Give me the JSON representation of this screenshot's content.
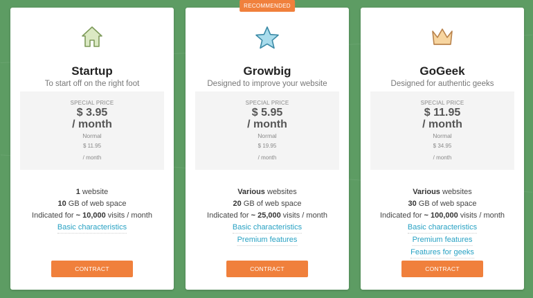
{
  "plans": [
    {
      "badge": "",
      "icon": "house-icon",
      "name": "Startup",
      "tagline": "To start off on the right foot",
      "special_label": "SPECIAL PRICE",
      "price": "$ 3.95",
      "per": "/ month",
      "normal_label": "Normal",
      "normal_price": "$ 11.95",
      "normal_per": "/ month",
      "feature_1_strong": "1",
      "feature_1_text": " website",
      "feature_2_strong": "10",
      "feature_2_text": " GB of web space",
      "feature_3_text": "Indicated for ",
      "feature_3_strong": "~ 10,000",
      "feature_3_suffix": " visits / month",
      "links": [
        "Basic characteristics"
      ],
      "cta": "CONTRACT"
    },
    {
      "badge": "RECOMMENDED",
      "icon": "star-icon",
      "name": "Growbig",
      "tagline": "Designed to improve your website",
      "special_label": "SPECIAL PRICE",
      "price": "$ 5.95",
      "per": "/ month",
      "normal_label": "Normal",
      "normal_price": "$ 19.95",
      "normal_per": "/ month",
      "feature_1_strong": "Various",
      "feature_1_text": " websites",
      "feature_2_strong": "20",
      "feature_2_text": " GB of web space",
      "feature_3_text": "Indicated for ",
      "feature_3_strong": "~ 25,000",
      "feature_3_suffix": " visits / month",
      "links": [
        "Basic characteristics",
        "Premium features"
      ],
      "cta": "CONTRACT"
    },
    {
      "badge": "",
      "icon": "crown-icon",
      "name": "GoGeek",
      "tagline": "Designed for authentic geeks",
      "special_label": "SPECIAL PRICE",
      "price": "$ 11.95",
      "per": "/ month",
      "normal_label": "Normal",
      "normal_price": "$ 34.95",
      "normal_per": "/ month",
      "feature_1_strong": "Various",
      "feature_1_text": " websites",
      "feature_2_strong": "30",
      "feature_2_text": " GB of web space",
      "feature_3_text": "Indicated for ",
      "feature_3_strong": "~ 100,000",
      "feature_3_suffix": " visits / month",
      "links": [
        "Basic characteristics",
        "Premium features",
        "Features for geeks"
      ],
      "cta": "CONTRACT"
    }
  ],
  "colors": {
    "background": "#5d9c63",
    "accent": "#f0803c",
    "link": "#27a1c3"
  }
}
